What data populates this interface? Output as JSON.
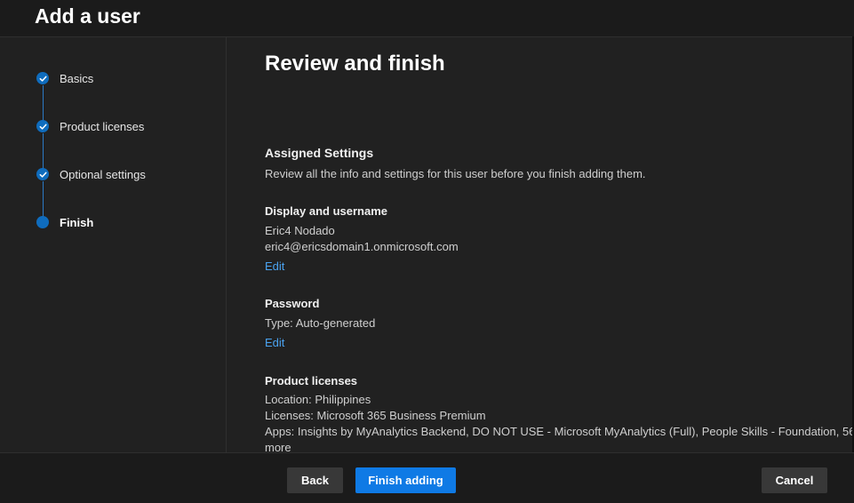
{
  "header": {
    "title": "Add a user"
  },
  "steps": [
    {
      "label": "Basics",
      "state": "complete",
      "icon": "checkmark-icon"
    },
    {
      "label": "Product licenses",
      "state": "complete",
      "icon": "checkmark-icon"
    },
    {
      "label": "Optional settings",
      "state": "complete",
      "icon": "checkmark-icon"
    },
    {
      "label": "Finish",
      "state": "current",
      "icon": "current-step-dot-icon"
    }
  ],
  "main": {
    "title": "Review and finish",
    "assigned": {
      "heading": "Assigned Settings",
      "description": "Review all the info and settings for this user before you finish adding them."
    },
    "display": {
      "heading": "Display and username",
      "name": "Eric4 Nodado",
      "email": "eric4@ericsdomain1.onmicrosoft.com",
      "edit": "Edit"
    },
    "password": {
      "heading": "Password",
      "type": "Type: Auto-generated",
      "edit": "Edit"
    },
    "licenses": {
      "heading": "Product licenses",
      "location": "Location: Philippines",
      "licenses": "Licenses: Microsoft 365 Business Premium",
      "apps_line1": "Apps: Insights by MyAnalytics Backend, DO NOT USE - Microsoft MyAnalytics (Full), People Skills - Foundation, 56",
      "apps_line2": "more"
    }
  },
  "footer": {
    "back": "Back",
    "finish": "Finish adding",
    "cancel": "Cancel"
  },
  "colors": {
    "accent": "#0f6cbd",
    "link": "#4aa3f0",
    "primary_button": "#0f7ae5"
  }
}
